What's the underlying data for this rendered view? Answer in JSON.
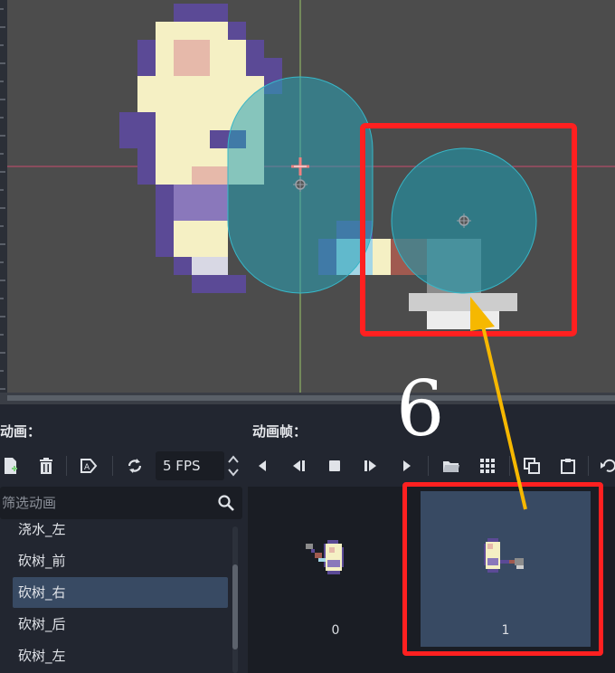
{
  "annotation": {
    "step_number": "6",
    "colors": {
      "highlight": "#ff2020",
      "arrow": "#f6b800"
    }
  },
  "animation_panel": {
    "header": "动画：",
    "filter_placeholder": "筛选动画",
    "items": [
      {
        "label": "浇水_左",
        "selected": false
      },
      {
        "label": "砍树_前",
        "selected": false
      },
      {
        "label": "砍树_右",
        "selected": true
      },
      {
        "label": "砍树_后",
        "selected": false
      },
      {
        "label": "砍树_左",
        "selected": false
      }
    ],
    "toolbar": {
      "new_icon": "new-animation-icon",
      "delete_icon": "trash-icon",
      "autoplay_icon": "autoplay-icon",
      "loop_icon": "loop-icon"
    }
  },
  "frames_panel": {
    "header": "动画帧：",
    "fps": "5 FPS",
    "frames": [
      {
        "index": "0"
      },
      {
        "index": "1"
      }
    ],
    "toolbar": [
      "play-backwards-icon",
      "play-backwards-from-end-icon",
      "stop-icon",
      "play-from-start-icon",
      "play-icon",
      "open-folder-icon",
      "grid-icon",
      "copy-icon",
      "paste-icon",
      "more-icon"
    ]
  }
}
